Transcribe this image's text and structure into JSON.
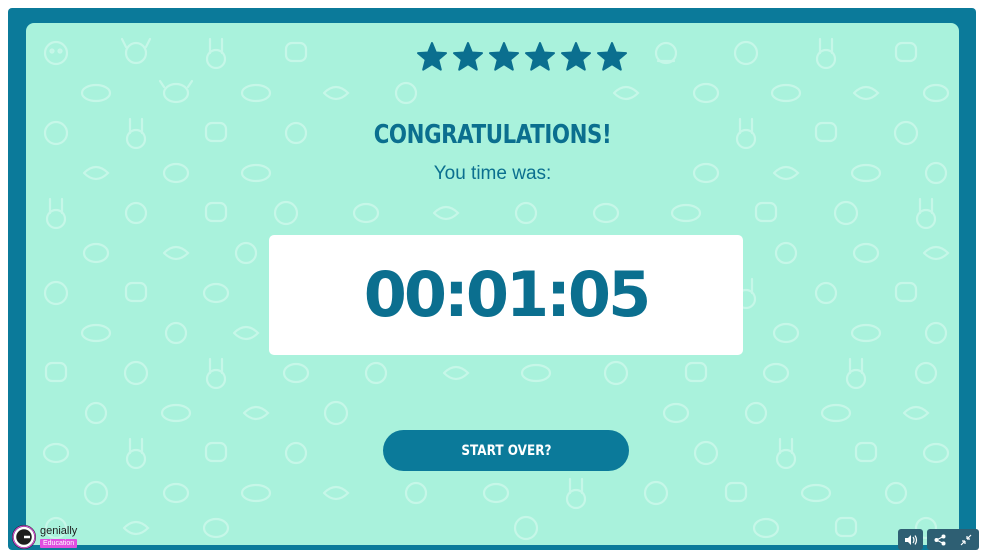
{
  "screen": {
    "title": "CONGRATULATIONS!",
    "subtitle": "You time was:",
    "stars": {
      "count": 6,
      "filled": 6,
      "color": "#0b6f8f"
    },
    "timer": "00:01:05",
    "start_over_label": "START OVER?"
  },
  "branding": {
    "name": "genially",
    "badge": "Education"
  },
  "controls": {
    "volume_icon": "speaker-icon",
    "share_icon": "share-icon",
    "fullscreen_icon": "collapse-icon"
  },
  "colors": {
    "frame": "#0b7a9a",
    "panel": "#a9f2dc",
    "accent": "#0b6f8f",
    "badge": "#e04fe0"
  }
}
